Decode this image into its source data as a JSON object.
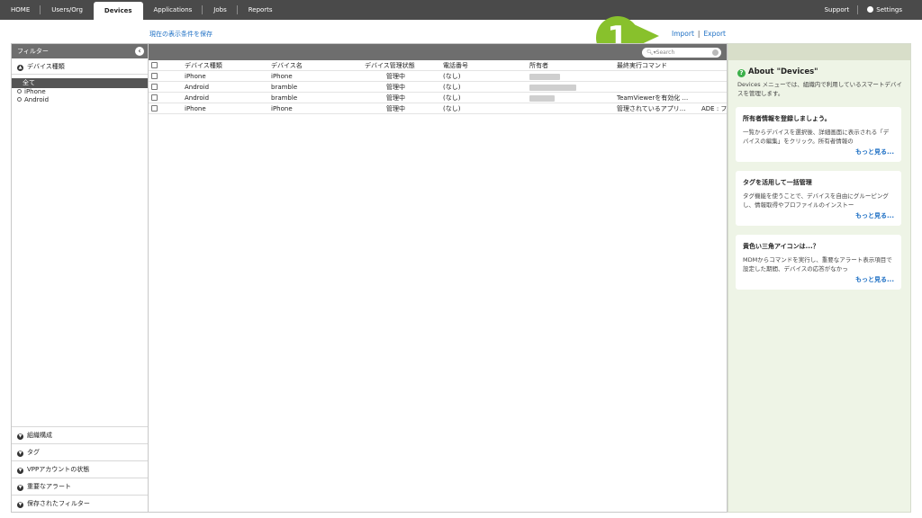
{
  "nav": {
    "items": [
      "HOME",
      "Users/Org",
      "Devices",
      "Applications",
      "Jobs",
      "Reports"
    ],
    "support": "Support",
    "settings": "Settings"
  },
  "toolbar": {
    "save_view": "現在の表示条件を保存",
    "import": "Import",
    "export": "Export",
    "separator": "|",
    "callout_number": "1"
  },
  "filter": {
    "header": "フィルター",
    "device_type_section": "デバイス種類",
    "all": "全て",
    "options": [
      "iPhone",
      "Android"
    ],
    "bottom_sections": [
      "組織構成",
      "タグ",
      "VPPアカウントの状態",
      "重要なアラート",
      "保存されたフィルター"
    ]
  },
  "search": {
    "placeholder": "Search"
  },
  "table": {
    "columns": [
      "デバイス種類",
      "デバイス名",
      "デバイス管理状態",
      "電話番号",
      "所有者",
      "最終実行コマンド"
    ],
    "rows": [
      [
        "iPhone",
        "iPhone",
        "管理中",
        "(なし)",
        "",
        "",
        ""
      ],
      [
        "Android",
        "bramble",
        "管理中",
        "(なし)",
        "",
        "",
        ""
      ],
      [
        "Android",
        "bramble",
        "管理中",
        "(なし)",
        "",
        "TeamViewerを有効化 ...",
        ""
      ],
      [
        "iPhone",
        "iPhone",
        "管理中",
        "(なし)",
        "",
        "管理されているアプリ...",
        "ADE : フ"
      ]
    ]
  },
  "help": {
    "title": "About \"Devices\"",
    "description": "Devices メニューでは、組織内で利用しているスマートデバイスを管理します。",
    "cards": [
      {
        "title": "所有者情報を登録しましょう。",
        "text": "一覧からデバイスを選択後、詳細画面に表示される「デバイスの編集」をクリック。所有者情報の",
        "more": "もっと見る..."
      },
      {
        "title": "タグを活用して一括管理",
        "text": "タグ機能を使うことで、デバイスを自由にグルーピングし、情報取得やプロファイルのインストー",
        "more": "もっと見る..."
      },
      {
        "title": "黄色い三角アイコンは...？",
        "text": "MDMからコマンドを実行し、重要なアラート表示項目で設定した期間、デバイスの応答がなかっ",
        "more": "もっと見る..."
      }
    ]
  },
  "colors": {
    "nav_bg": "#4a4a4a",
    "link": "#1d6fc4",
    "callout": "#88c12c",
    "help_bg": "#eef4e6"
  }
}
